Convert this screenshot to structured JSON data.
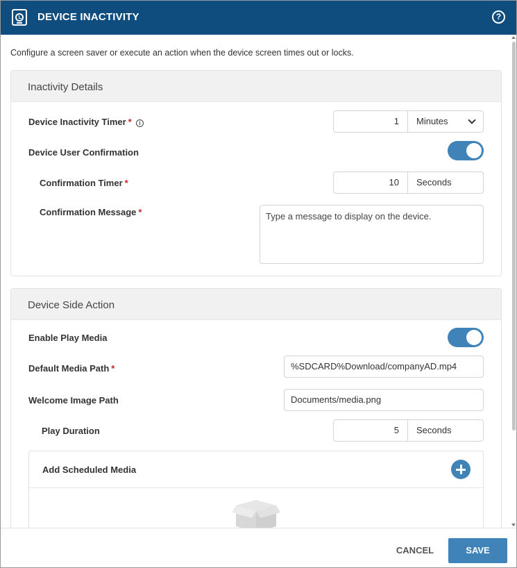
{
  "header": {
    "title": "DEVICE INACTIVITY",
    "app_icon": "device-clock-icon",
    "help_icon": "?"
  },
  "intro": "Configure a screen saver or execute an action when the device screen times out or locks.",
  "inactivity": {
    "title": "Inactivity Details",
    "timer": {
      "label": "Device Inactivity Timer",
      "required": "*",
      "info_icon": "i",
      "value": "1",
      "unit": "Minutes"
    },
    "confirmation": {
      "label": "Device User Confirmation",
      "enabled": true
    },
    "confirmation_timer": {
      "label": "Confirmation Timer",
      "required": "*",
      "value": "10",
      "unit": "Seconds"
    },
    "confirmation_message": {
      "label": "Confirmation Message",
      "required": "*",
      "placeholder": "Type a message to display on the device."
    }
  },
  "side_action": {
    "title": "Device Side Action",
    "play_media": {
      "label": "Enable Play Media",
      "enabled": true
    },
    "default_media_path": {
      "label": "Default Media Path",
      "required": "*",
      "value": "%SDCARD%Download/companyAD.mp4"
    },
    "welcome_image_path": {
      "label": "Welcome Image Path",
      "value": "Documents/media.png"
    },
    "play_duration": {
      "label": "Play Duration",
      "value": "5",
      "unit": "Seconds"
    },
    "scheduled_media": {
      "label": "Add Scheduled Media",
      "add_icon": "plus-circle-icon",
      "empty_icon": "empty-box-icon"
    }
  },
  "footer": {
    "cancel_label": "CANCEL",
    "save_label": "SAVE"
  },
  "colors": {
    "header_bg": "#0f4d7e",
    "accent": "#3f83b8",
    "required": "#c62828"
  }
}
